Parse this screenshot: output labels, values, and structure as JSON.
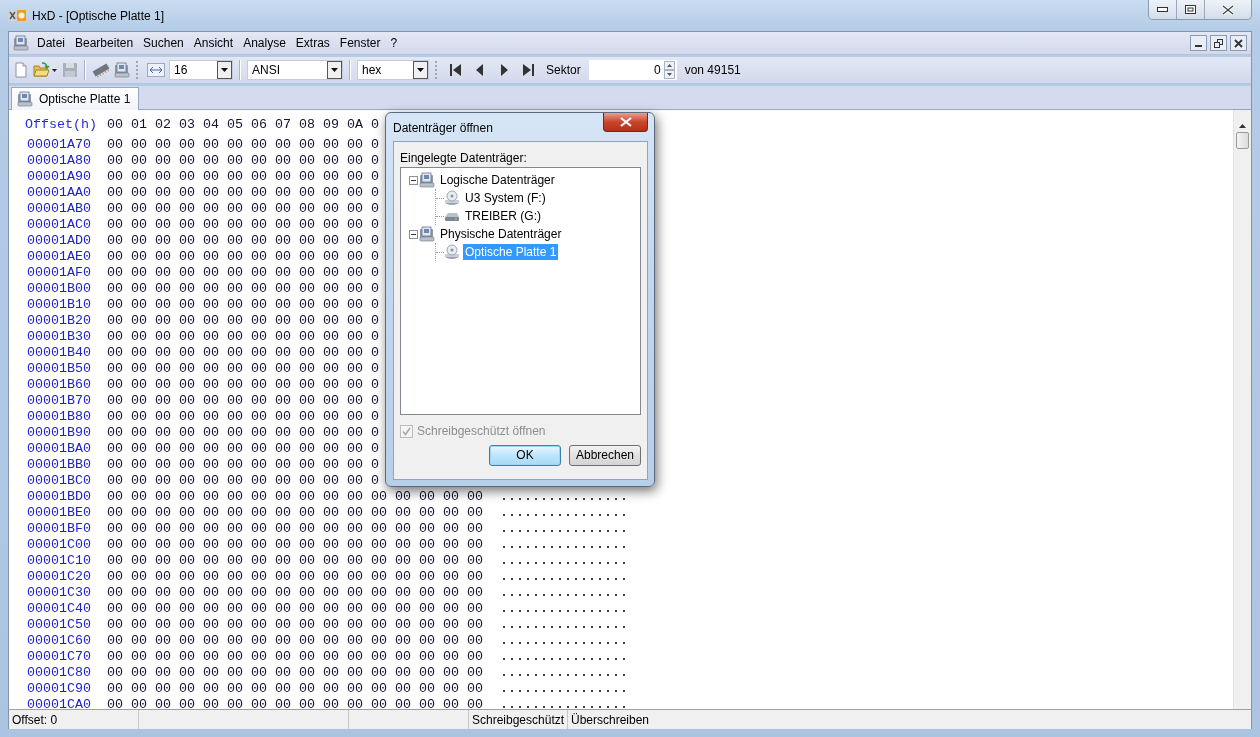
{
  "window": {
    "title": "HxD - [Optische Platte 1]"
  },
  "menu": [
    "Datei",
    "Bearbeiten",
    "Suchen",
    "Ansicht",
    "Analyse",
    "Extras",
    "Fenster",
    "?"
  ],
  "toolbar": {
    "bytes_per_row": "16",
    "charset": "ANSI",
    "offset_base": "hex",
    "sector_label": "Sektor",
    "sector": "0",
    "sector_total": "von 49151"
  },
  "tabs": [
    {
      "label": "Optische Platte 1",
      "selected": true
    }
  ],
  "hex_view": {
    "offset_header": "Offset(h)",
    "column_header": "00 01 02 03 04 05 06 07 08 09 0A 0",
    "rows": [
      {
        "offset": "00001A70",
        "hex": "00 00 00 00 00 00 00 00 00 00 00 0"
      },
      {
        "offset": "00001A80",
        "hex": "00 00 00 00 00 00 00 00 00 00 00 0"
      },
      {
        "offset": "00001A90",
        "hex": "00 00 00 00 00 00 00 00 00 00 00 0"
      },
      {
        "offset": "00001AA0",
        "hex": "00 00 00 00 00 00 00 00 00 00 00 0"
      },
      {
        "offset": "00001AB0",
        "hex": "00 00 00 00 00 00 00 00 00 00 00 0"
      },
      {
        "offset": "00001AC0",
        "hex": "00 00 00 00 00 00 00 00 00 00 00 0"
      },
      {
        "offset": "00001AD0",
        "hex": "00 00 00 00 00 00 00 00 00 00 00 0"
      },
      {
        "offset": "00001AE0",
        "hex": "00 00 00 00 00 00 00 00 00 00 00 0"
      },
      {
        "offset": "00001AF0",
        "hex": "00 00 00 00 00 00 00 00 00 00 00 0"
      },
      {
        "offset": "00001B00",
        "hex": "00 00 00 00 00 00 00 00 00 00 00 0"
      },
      {
        "offset": "00001B10",
        "hex": "00 00 00 00 00 00 00 00 00 00 00 0"
      },
      {
        "offset": "00001B20",
        "hex": "00 00 00 00 00 00 00 00 00 00 00 0"
      },
      {
        "offset": "00001B30",
        "hex": "00 00 00 00 00 00 00 00 00 00 00 0"
      },
      {
        "offset": "00001B40",
        "hex": "00 00 00 00 00 00 00 00 00 00 00 0"
      },
      {
        "offset": "00001B50",
        "hex": "00 00 00 00 00 00 00 00 00 00 00 0"
      },
      {
        "offset": "00001B60",
        "hex": "00 00 00 00 00 00 00 00 00 00 00 0"
      },
      {
        "offset": "00001B70",
        "hex": "00 00 00 00 00 00 00 00 00 00 00 0"
      },
      {
        "offset": "00001B80",
        "hex": "00 00 00 00 00 00 00 00 00 00 00 0"
      },
      {
        "offset": "00001B90",
        "hex": "00 00 00 00 00 00 00 00 00 00 00 0"
      },
      {
        "offset": "00001BA0",
        "hex": "00 00 00 00 00 00 00 00 00 00 00 0"
      },
      {
        "offset": "00001BB0",
        "hex": "00 00 00 00 00 00 00 00 00 00 00 0"
      },
      {
        "offset": "00001BC0",
        "hex": "00 00 00 00 00 00 00 00 00 00 00 0"
      },
      {
        "offset": "00001BD0",
        "hex": "00 00 00 00 00 00 00 00 00 00 00 00 00 00 00 00",
        "ascii": "................"
      },
      {
        "offset": "00001BE0",
        "hex": "00 00 00 00 00 00 00 00 00 00 00 00 00 00 00 00",
        "ascii": "................"
      },
      {
        "offset": "00001BF0",
        "hex": "00 00 00 00 00 00 00 00 00 00 00 00 00 00 00 00",
        "ascii": "................"
      },
      {
        "offset": "00001C00",
        "hex": "00 00 00 00 00 00 00 00 00 00 00 00 00 00 00 00",
        "ascii": "................"
      },
      {
        "offset": "00001C10",
        "hex": "00 00 00 00 00 00 00 00 00 00 00 00 00 00 00 00",
        "ascii": "................"
      },
      {
        "offset": "00001C20",
        "hex": "00 00 00 00 00 00 00 00 00 00 00 00 00 00 00 00",
        "ascii": "................"
      },
      {
        "offset": "00001C30",
        "hex": "00 00 00 00 00 00 00 00 00 00 00 00 00 00 00 00",
        "ascii": "................"
      },
      {
        "offset": "00001C40",
        "hex": "00 00 00 00 00 00 00 00 00 00 00 00 00 00 00 00",
        "ascii": "................"
      },
      {
        "offset": "00001C50",
        "hex": "00 00 00 00 00 00 00 00 00 00 00 00 00 00 00 00",
        "ascii": "................"
      },
      {
        "offset": "00001C60",
        "hex": "00 00 00 00 00 00 00 00 00 00 00 00 00 00 00 00",
        "ascii": "................"
      },
      {
        "offset": "00001C70",
        "hex": "00 00 00 00 00 00 00 00 00 00 00 00 00 00 00 00",
        "ascii": "................"
      },
      {
        "offset": "00001C80",
        "hex": "00 00 00 00 00 00 00 00 00 00 00 00 00 00 00 00",
        "ascii": "................"
      },
      {
        "offset": "00001C90",
        "hex": "00 00 00 00 00 00 00 00 00 00 00 00 00 00 00 00",
        "ascii": "................"
      },
      {
        "offset": "00001CA0",
        "hex": "00 00 00 00 00 00 00 00 00 00 00 00 00 00 00 00",
        "ascii": "................"
      }
    ]
  },
  "status_bar": {
    "offset": "Offset: 0",
    "protection": "Schreibgeschützt",
    "edit_mode": "Überschreiben"
  },
  "dialog": {
    "title": "Datenträger öffnen",
    "tree_label": "Eingelegte Datenträger:",
    "tree": [
      {
        "label": "Logische Datenträger",
        "kind": "group",
        "expanded": true,
        "selected": false,
        "children": [
          {
            "label": "U3 System (F:)",
            "kind": "optical",
            "selected": false
          },
          {
            "label": "TREIBER (G:)",
            "kind": "drive",
            "selected": false
          }
        ]
      },
      {
        "label": "Physische Datenträger",
        "kind": "group",
        "expanded": true,
        "selected": false,
        "children": [
          {
            "label": "Optische Platte 1",
            "kind": "optical",
            "selected": true
          }
        ]
      }
    ],
    "readonly": {
      "label": "Schreibgeschützt öffnen",
      "checked": true,
      "disabled": true
    },
    "buttons": [
      {
        "label": "OK",
        "default": true
      },
      {
        "label": "Abbrechen",
        "default": false
      }
    ]
  }
}
